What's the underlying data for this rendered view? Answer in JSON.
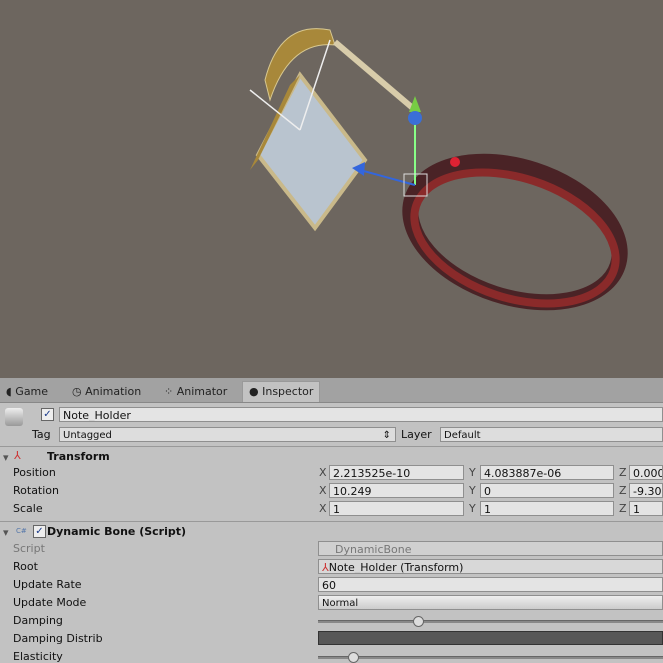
{
  "tabs": [
    {
      "label": "Game",
      "icon": "game-icon"
    },
    {
      "label": "Animation",
      "icon": "clock-icon"
    },
    {
      "label": "Animator",
      "icon": "animator-icon"
    },
    {
      "label": "Inspector",
      "icon": "info-icon"
    }
  ],
  "object": {
    "name": "Note_Holder",
    "active": true,
    "tag_label": "Tag",
    "tag": "Untagged",
    "layer_label": "Layer",
    "layer": "Default"
  },
  "transform": {
    "title": "Transform",
    "position": {
      "label": "Position",
      "x": "2.213525e-10",
      "y": "4.083887e-06",
      "z": "0.000"
    },
    "rotation": {
      "label": "Rotation",
      "x": "10.249",
      "y": "0",
      "z": "-9.30"
    },
    "scale": {
      "label": "Scale",
      "x": "1",
      "y": "1",
      "z": "1"
    }
  },
  "axes": {
    "x": "X",
    "y": "Y",
    "z": "Z"
  },
  "dynamic_bone": {
    "title": "Dynamic Bone (Script)",
    "enabled": true,
    "script_label": "Script",
    "script": "DynamicBone",
    "root_label": "Root",
    "root": "Note_Holder (Transform)",
    "update_rate_label": "Update Rate",
    "update_rate": "60",
    "update_mode_label": "Update Mode",
    "update_mode": "Normal",
    "damping_label": "Damping",
    "damping": 0.29,
    "damping_distrib_label": "Damping Distrib",
    "elasticity_label": "Elasticity",
    "elasticity": 0.1
  }
}
